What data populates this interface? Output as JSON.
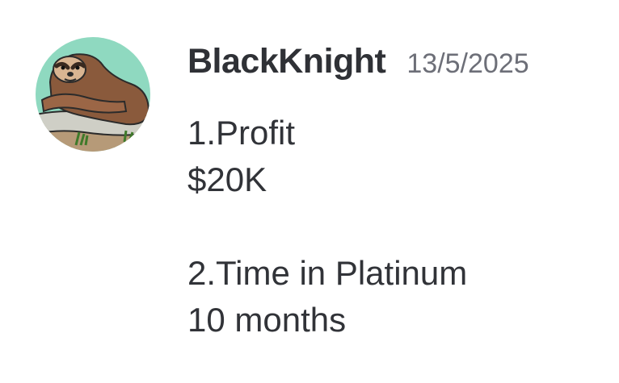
{
  "message": {
    "avatar_icon": "sloth-avatar-icon",
    "username": "BlackKnight",
    "timestamp": "13/5/2025",
    "lines": [
      "1.Profit",
      "$20K",
      "",
      "2.Time in Platinum",
      "10 months"
    ]
  },
  "colors": {
    "avatar_background": "#8fd9c0",
    "username": "#2f3136",
    "timestamp": "#6d6f78",
    "text": "#313338"
  }
}
